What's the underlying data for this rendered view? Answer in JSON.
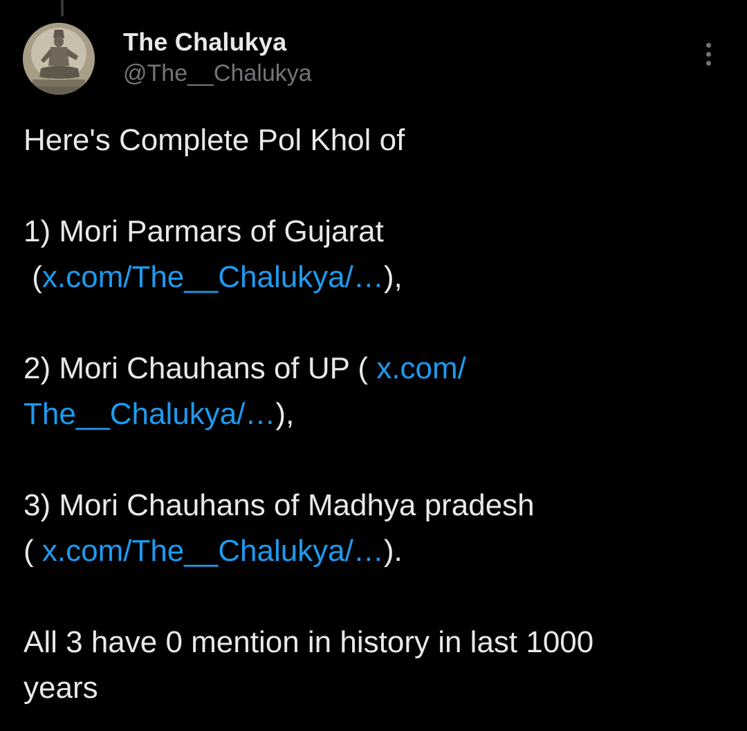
{
  "author": {
    "display_name": "The Chalukya",
    "handle": "@The__Chalukya"
  },
  "icons": {
    "avatar": "sculpture-avatar",
    "more": "more-vertical-icon"
  },
  "colors": {
    "background": "#000000",
    "text": "#e7e9ea",
    "muted": "#71767b",
    "link": "#1d9bf0"
  },
  "tweet": {
    "intro": "Here's Complete Pol Khol of",
    "item1": {
      "text": "1) Mori Parmars of Gujarat",
      "pre": " (",
      "link": "x.com/The__Chalukya/…",
      "post": "),"
    },
    "item2": {
      "text": "2) Mori Chauhans of UP ( ",
      "link_part1": "x.com/",
      "link_part2": "The__Chalukya/…",
      "post": "),"
    },
    "item3": {
      "text": "3) Mori Chauhans of Madhya pradesh",
      "pre": "( ",
      "link": "x.com/The__Chalukya/…",
      "post": ")."
    },
    "closing_line1": "All 3 have 0 mention in history in last 1000",
    "closing_line2": "years"
  }
}
